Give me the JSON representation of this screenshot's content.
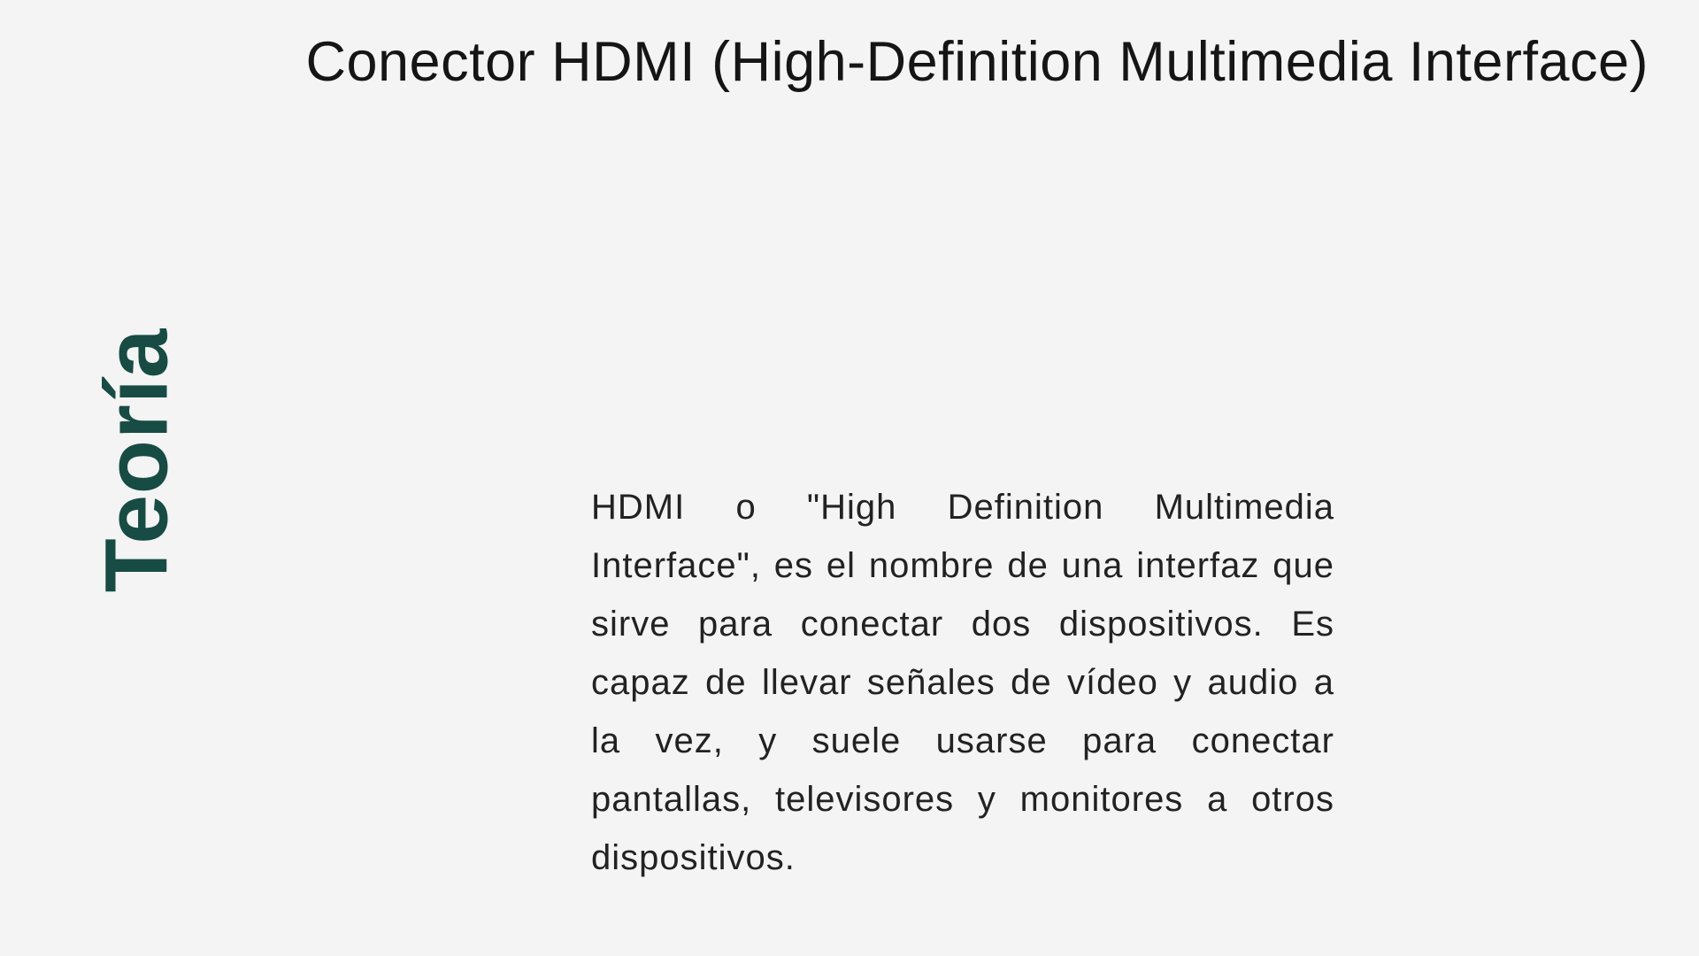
{
  "slide": {
    "title": "Conector HDMI (High-Definition Multimedia Interface)",
    "section_label": "Teoría",
    "body": "HDMI o \"High Definition Multimedia Interface\", es el nombre de una interfaz que sirve para conectar dos dispositivos. Es capaz de llevar señales de vídeo y audio a la vez, y suele usarse para conectar pantallas, televisores y monitores a otros dispositivos."
  },
  "colors": {
    "background": "#f4f4f4",
    "accent": "#164c44",
    "text": "#1d1d1d"
  }
}
